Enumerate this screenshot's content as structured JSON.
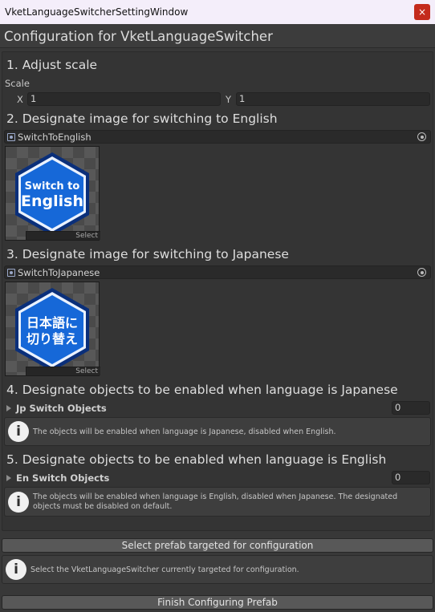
{
  "window": {
    "title": "VketLanguageSwitcherSettingWindow",
    "close_glyph": "×"
  },
  "header": {
    "title": "Configuration for VketLanguageSwitcher"
  },
  "section1": {
    "heading": "1. Adjust scale",
    "scale_label": "Scale",
    "x_label": "X",
    "x_value": "1",
    "y_label": "Y",
    "y_value": "1"
  },
  "section2": {
    "heading": "2. Designate image for switching to English",
    "object_name": "SwitchToEnglish",
    "image_lines": [
      "Switch to",
      "English"
    ],
    "select_label": "Select"
  },
  "section3": {
    "heading": "3. Designate image for switching to Japanese",
    "object_name": "SwitchToJapanese",
    "image_lines": [
      "日本語に",
      "切り替え"
    ],
    "select_label": "Select"
  },
  "section4": {
    "heading": "4. Designate objects to be enabled when language is Japanese",
    "foldout_label": "Jp Switch Objects",
    "count": "0",
    "help_icon": "i",
    "help_text": "The objects will be enabled when language is Japanese, disabled when English."
  },
  "section5": {
    "heading": "5. Designate objects to be enabled when language is English",
    "foldout_label": "En Switch Objects",
    "count": "0",
    "help_icon": "i",
    "help_line1": "The objects will be enabled when language is English, disabled when Japanese. The designated",
    "help_line2": "objects must be disabled on default."
  },
  "footer": {
    "select_prefab_button": "Select prefab targeted for configuration",
    "help_icon": "i",
    "help_text": "Select the VketLanguageSwitcher currently targeted for configuration.",
    "finish_button": "Finish Configuring Prefab"
  },
  "colors": {
    "badge_blue": "#1668d8",
    "badge_border": "#0a2f7a",
    "close_red": "#c42b1c"
  }
}
